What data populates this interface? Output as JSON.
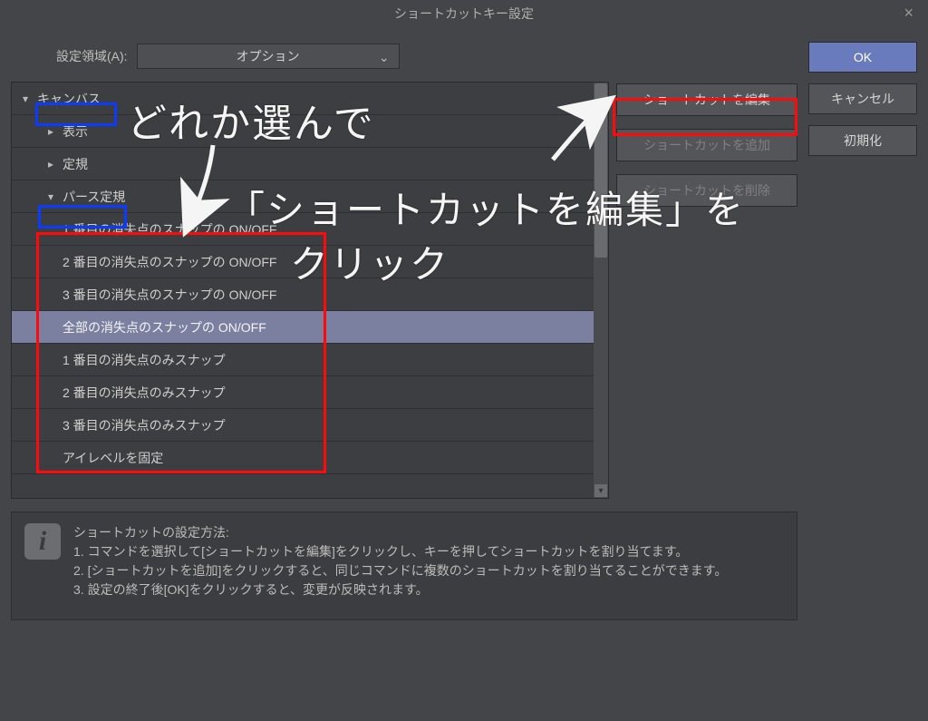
{
  "window": {
    "title": "ショートカットキー設定"
  },
  "settingArea": {
    "label": "設定領域(A):",
    "selected": "オプション"
  },
  "tree": {
    "items": [
      {
        "label": "キャンバス",
        "level": 1,
        "expand": "down",
        "selected": false
      },
      {
        "label": "表示",
        "level": 2,
        "expand": "right",
        "selected": false
      },
      {
        "label": "定規",
        "level": 2,
        "expand": "right",
        "selected": false
      },
      {
        "label": "パース定規",
        "level": 2,
        "expand": "down",
        "selected": false
      },
      {
        "label": "1 番目の消失点のスナップの ON/OFF",
        "level": 3,
        "selected": false
      },
      {
        "label": "2 番目の消失点のスナップの ON/OFF",
        "level": 3,
        "selected": false
      },
      {
        "label": "3 番目の消失点のスナップの ON/OFF",
        "level": 3,
        "selected": false
      },
      {
        "label": "全部の消失点のスナップの ON/OFF",
        "level": 3,
        "selected": true
      },
      {
        "label": "1 番目の消失点のみスナップ",
        "level": 3,
        "selected": false
      },
      {
        "label": "2 番目の消失点のみスナップ",
        "level": 3,
        "selected": false
      },
      {
        "label": "3 番目の消失点のみスナップ",
        "level": 3,
        "selected": false
      },
      {
        "label": "アイレベルを固定",
        "level": 3,
        "selected": false
      }
    ]
  },
  "sideButtons": {
    "edit": "ショートカットを編集",
    "add": "ショートカットを追加",
    "delete": "ショートカットを削除"
  },
  "rightButtons": {
    "ok": "OK",
    "cancel": "キャンセル",
    "reset": "初期化"
  },
  "info": {
    "heading": "ショートカットの設定方法:",
    "line1": "1. コマンドを選択して[ショートカットを編集]をクリックし、キーを押してショートカットを割り当てます。",
    "line2": "2. [ショートカットを追加]をクリックすると、同じコマンドに複数のショートカットを割り当てることができます。",
    "line3": "3. 設定の終了後[OK]をクリックすると、変更が反映されます。"
  },
  "annotation": {
    "t1": "どれか選んで",
    "t2": "「ショートカットを編集」を",
    "t3": "クリック"
  }
}
